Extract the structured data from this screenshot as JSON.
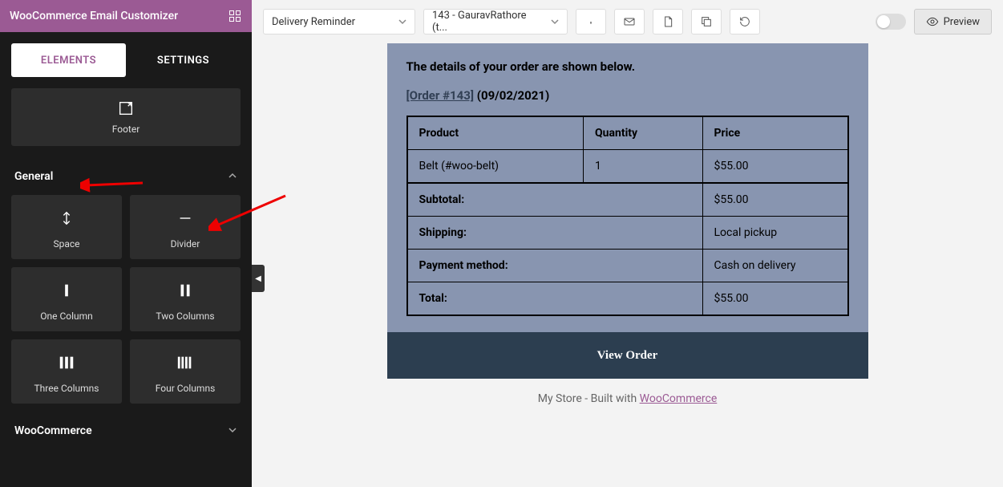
{
  "app_title": "WooCommerce Email Customizer",
  "tabs": {
    "elements": "ELEMENTS",
    "settings": "SETTINGS"
  },
  "widgets": {
    "footer": "Footer",
    "space": "Space",
    "divider": "Divider",
    "one_column": "One Column",
    "two_columns": "Two Columns",
    "three_columns": "Three Columns",
    "four_columns": "Four Columns"
  },
  "sections": {
    "general": "General",
    "woocommerce": "WooCommerce"
  },
  "topbar": {
    "template_select": "Delivery Reminder",
    "order_select": "143 - GauravRathore (t...",
    "preview": "Preview"
  },
  "email": {
    "intro": "The details of your order are shown below.",
    "order_label": "[Order #143]",
    "order_date": "(09/02/2021)",
    "headers": {
      "product": "Product",
      "quantity": "Quantity",
      "price": "Price"
    },
    "items": [
      {
        "product": "Belt (#woo-belt)",
        "qty": "1",
        "price": "$55.00"
      }
    ],
    "subtotal_label": "Subtotal:",
    "subtotal_value": "$55.00",
    "shipping_label": "Shipping:",
    "shipping_value": "Local pickup",
    "payment_label": "Payment method:",
    "payment_value": "Cash on delivery",
    "total_label": "Total:",
    "total_value": "$55.00",
    "view_order": "View Order",
    "footer_prefix": "My Store - Built with ",
    "footer_link": "WooCommerce"
  }
}
